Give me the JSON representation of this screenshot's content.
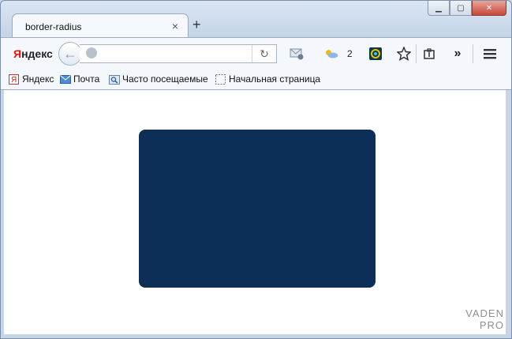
{
  "window": {
    "minimize_label": "▁",
    "maximize_label": "▢",
    "close_label": "✕"
  },
  "tabs": [
    {
      "title": "border-radius",
      "close_label": "×"
    }
  ],
  "new_tab_label": "+",
  "toolbar": {
    "brand_first": "Я",
    "brand_rest": "ндекс",
    "back_label": "←",
    "url_value": "",
    "reload_label": "↻",
    "weather_count": "2"
  },
  "bookmarks": [
    {
      "label": "Яндекс"
    },
    {
      "label": "Почта"
    },
    {
      "label": "Часто посещаемые"
    },
    {
      "label": "Начальная страница"
    }
  ],
  "page": {
    "demo_box_color": "#0d2e56",
    "watermark_line1": "VADEN",
    "watermark_line2": "PRO"
  }
}
